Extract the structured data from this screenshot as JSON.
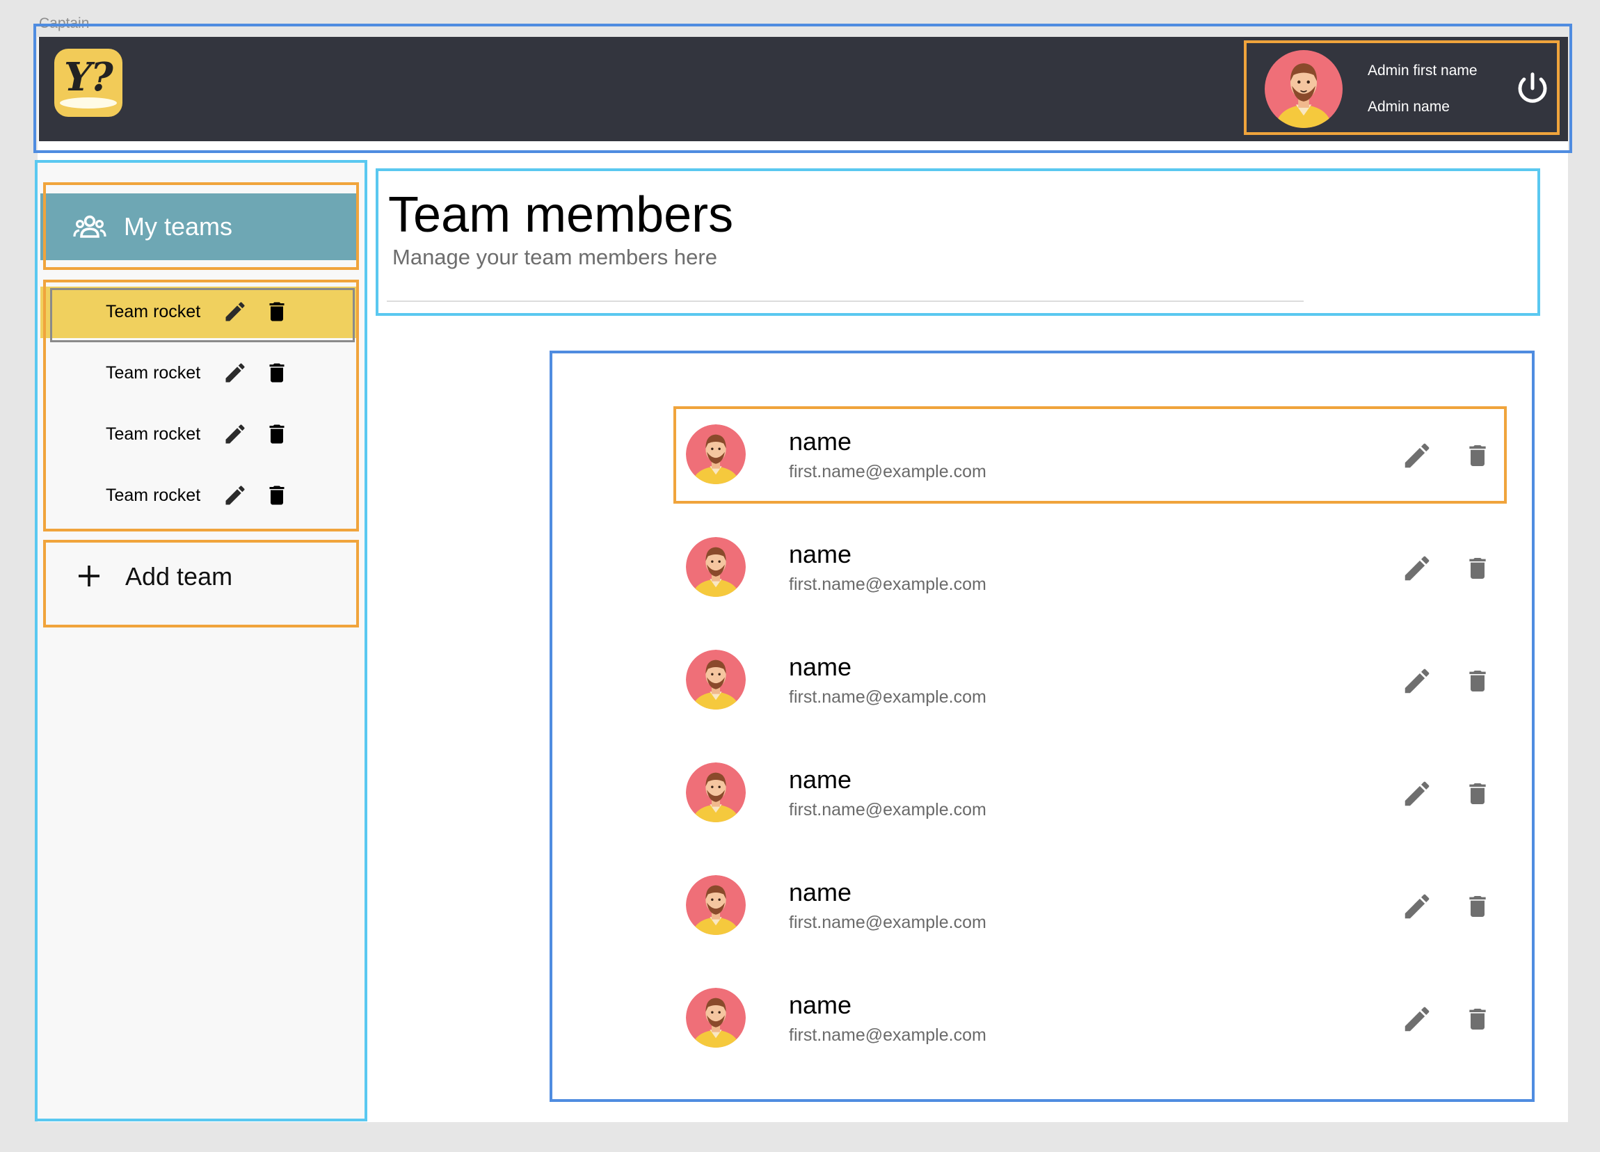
{
  "frame_label": "Captain",
  "header": {
    "logo_text": "Y?",
    "admin_first_name": "Admin first name",
    "admin_name": "Admin name"
  },
  "sidebar": {
    "my_teams_label": "My teams",
    "teams": [
      {
        "label": "Team rocket",
        "active": true
      },
      {
        "label": "Team rocket",
        "active": false
      },
      {
        "label": "Team rocket",
        "active": false
      },
      {
        "label": "Team rocket",
        "active": false
      }
    ],
    "add_team_label": "Add team"
  },
  "main": {
    "title": "Team members",
    "subtitle": "Manage your team members here",
    "members": [
      {
        "name": "name",
        "email": "first.name@example.com"
      },
      {
        "name": "name",
        "email": "first.name@example.com"
      },
      {
        "name": "name",
        "email": "first.name@example.com"
      },
      {
        "name": "name",
        "email": "first.name@example.com"
      },
      {
        "name": "name",
        "email": "first.name@example.com"
      },
      {
        "name": "name",
        "email": "first.name@example.com"
      }
    ]
  },
  "colors": {
    "header_bg": "#33353e",
    "logo_bg": "#f2cb58",
    "my_teams_bg": "#6ea7b4",
    "active_team_bg": "#f0d05e",
    "icon_grey": "#6f6f6f"
  },
  "icons": [
    "logo-icon",
    "admin-avatar-icon",
    "power-icon",
    "group-icon",
    "pencil-icon",
    "trash-icon",
    "plus-icon",
    "member-avatar-icon"
  ]
}
